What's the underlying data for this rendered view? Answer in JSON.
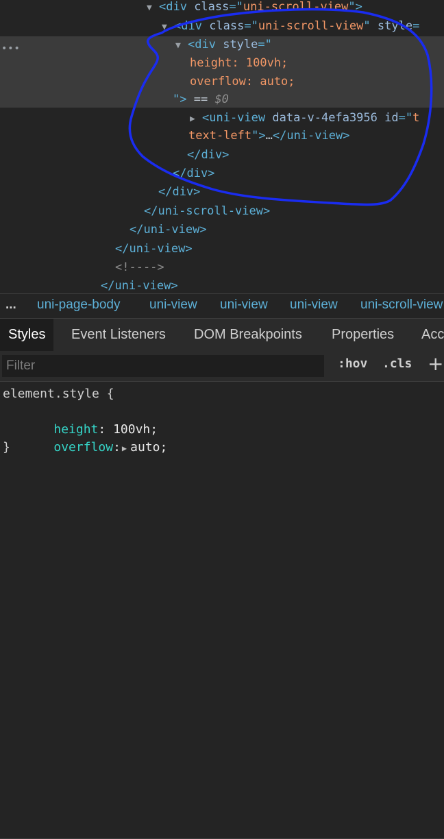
{
  "dom_lines": [
    {
      "tri": "▼",
      "parts": [
        [
          "tag",
          "<div "
        ],
        [
          "attr",
          "class"
        ],
        [
          "tag",
          "=\""
        ],
        [
          "val",
          "uni-scroll-view"
        ],
        [
          "tag",
          "\">"
        ]
      ]
    },
    {
      "tri": "▼",
      "parts": [
        [
          "tag",
          "<div "
        ],
        [
          "attr",
          "class"
        ],
        [
          "tag",
          "=\""
        ],
        [
          "val",
          "uni-scroll-view"
        ],
        [
          "tag",
          "\" "
        ],
        [
          "attr",
          "style"
        ],
        [
          "tag",
          "="
        ]
      ]
    },
    {
      "tri": "▼",
      "parts": [
        [
          "tag",
          "<div "
        ],
        [
          "attr",
          "style"
        ],
        [
          "tag",
          "=\""
        ]
      ]
    },
    {
      "tri": "",
      "parts": [
        [
          "val",
          "height: 100vh;"
        ]
      ]
    },
    {
      "tri": "",
      "parts": [
        [
          "val",
          "overflow: auto;"
        ]
      ]
    },
    {
      "tri": "",
      "parts": [
        [
          "tag",
          "\">"
        ],
        [
          "plain",
          " == "
        ],
        [
          "dim",
          "$0"
        ]
      ]
    },
    {
      "tri": "▶",
      "parts": [
        [
          "tag",
          "<uni-view "
        ],
        [
          "attr",
          "data-v-4efa3956 id"
        ],
        [
          "tag",
          "=\""
        ],
        [
          "val",
          "t"
        ]
      ]
    },
    {
      "tri": "",
      "parts": [
        [
          "val",
          "text-left"
        ],
        [
          "tag",
          "\">"
        ],
        [
          "plain",
          "…"
        ],
        [
          "tag",
          "</uni-view>"
        ]
      ]
    },
    {
      "tri": "",
      "parts": [
        [
          "tag",
          "</div>"
        ]
      ]
    },
    {
      "tri": "",
      "parts": [
        [
          "tag",
          "</div>"
        ]
      ]
    },
    {
      "tri": "",
      "parts": [
        [
          "tag",
          "</div>"
        ]
      ]
    },
    {
      "tri": "",
      "parts": [
        [
          "tag",
          "</uni-scroll-view>"
        ]
      ]
    },
    {
      "tri": "",
      "parts": [
        [
          "tag",
          "</uni-view>"
        ]
      ]
    },
    {
      "tri": "",
      "parts": [
        [
          "tag",
          "</uni-view>"
        ]
      ]
    },
    {
      "tri": "",
      "parts": [
        [
          "comment",
          "<!---->"
        ]
      ]
    },
    {
      "tri": "",
      "parts": [
        [
          "tag",
          "</uni-view>"
        ]
      ]
    }
  ],
  "gutter_dots": "•••",
  "breadcrumb": {
    "ellipsis": "...",
    "items": [
      "uni-page-body",
      "uni-view",
      "uni-view",
      "uni-view",
      "uni-scroll-view"
    ]
  },
  "tabs": [
    "Styles",
    "Event Listeners",
    "DOM Breakpoints",
    "Properties",
    "Acc"
  ],
  "filter": {
    "placeholder": "Filter",
    "value": ""
  },
  "toolbar": {
    "hov": ":hov",
    "cls": ".cls",
    "plus": "+"
  },
  "styles": {
    "selector": "element.style {",
    "props": [
      {
        "name": "height",
        "sep": ": ",
        "arrow": "",
        "value": "100vh",
        "end": ";"
      },
      {
        "name": "overflow",
        "sep": ":",
        "arrow": "▶",
        "value": "auto",
        "end": ";"
      }
    ],
    "close": "}"
  },
  "colors": {
    "annotation": "#1a2cf0",
    "tag": "#5db0d7",
    "value": "#f29766",
    "property": "#35d4c7"
  }
}
